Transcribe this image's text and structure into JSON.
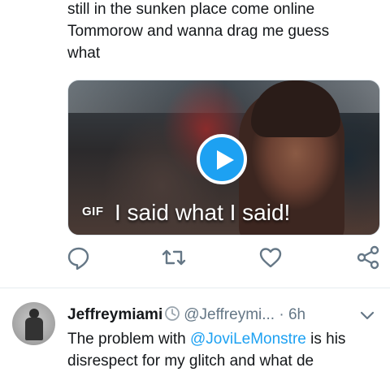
{
  "tweet": {
    "text_lines": [
      "still in the sunken place come online",
      "Tommorow and wanna drag me guess",
      "what"
    ],
    "media": {
      "type_badge": "GIF",
      "caption": "I said what I said!",
      "play_icon": "play-icon"
    },
    "actions": [
      {
        "name": "reply",
        "icon": "reply-icon"
      },
      {
        "name": "retweet",
        "icon": "retweet-icon"
      },
      {
        "name": "like",
        "icon": "heart-icon"
      },
      {
        "name": "share",
        "icon": "share-icon"
      }
    ]
  },
  "next_tweet": {
    "display_name": "Jeffreymiami",
    "badge_icon": "clock-icon",
    "handle": "@Jeffreymi...",
    "separator": "·",
    "time": "6h",
    "menu_icon": "chevron-down-icon",
    "text_prefix": "The problem with ",
    "mention": "@JoviLeMonstre",
    "text_suffix": " is his",
    "text_line2": "disrespect for my glitch and what de"
  },
  "colors": {
    "accent": "#1da1f2",
    "text": "#14171a",
    "muted": "#657786",
    "divider": "#e6ecf0"
  }
}
